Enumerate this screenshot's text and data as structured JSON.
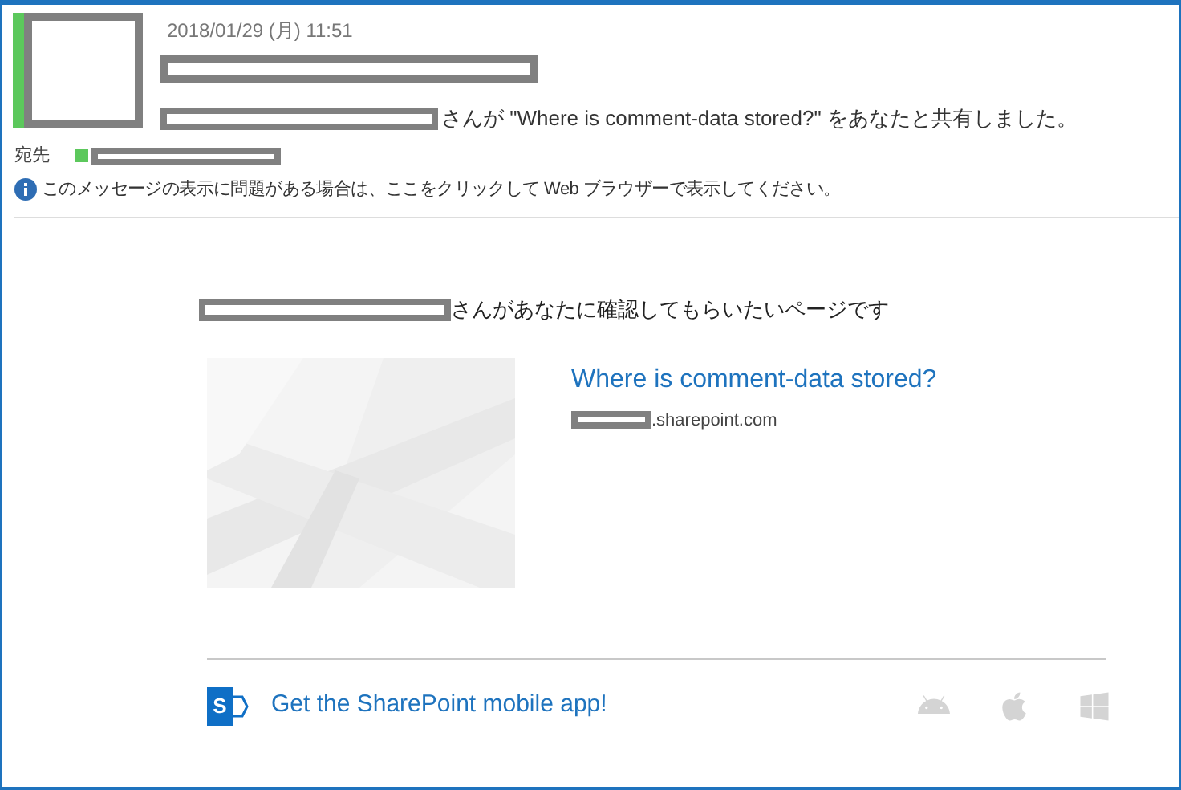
{
  "message": {
    "date": "2018/01/29 (月) 11:51",
    "sender_online": true,
    "shared_text": "さんが \"Where is comment-data stored?\" をあなたと共有しました。",
    "to_label": "宛先",
    "recipients": [
      {
        "online": true
      }
    ],
    "info_notice": "このメッセージの表示に問題がある場合は、ここをクリックして Web ブラウザーで表示してください。"
  },
  "card": {
    "intro": "さんがあなたに確認してもらいたいページです",
    "title": "Where is comment-data stored?",
    "domain": ".sharepoint.com"
  },
  "footer": {
    "logo_letter": "S",
    "app_link": "Get the SharePoint mobile app!",
    "platforms": [
      {
        "kind": "android"
      },
      {
        "kind": "apple"
      },
      {
        "kind": "windows"
      }
    ]
  }
}
